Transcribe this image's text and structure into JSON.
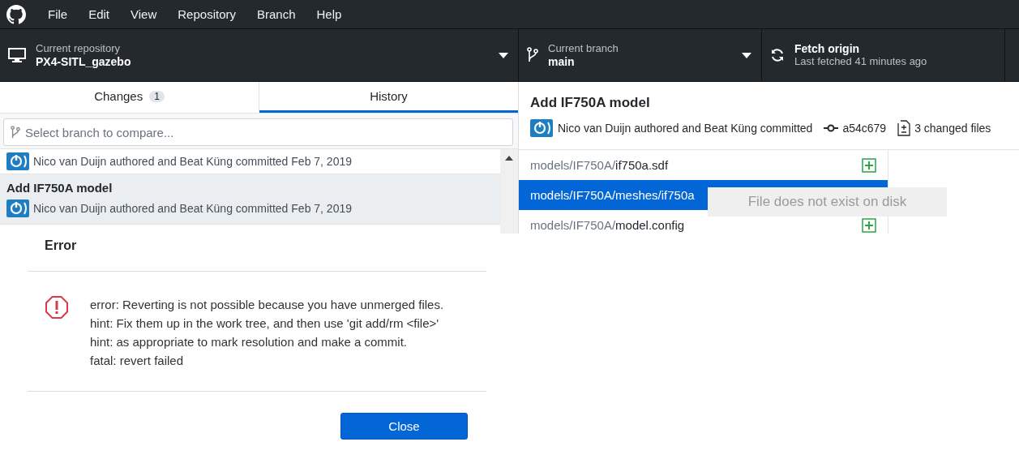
{
  "menu": [
    "File",
    "Edit",
    "View",
    "Repository",
    "Branch",
    "Help"
  ],
  "toolbar": {
    "repository": {
      "label": "Current repository",
      "value": "PX4-SITL_gazebo"
    },
    "branch": {
      "label": "Current branch",
      "value": "main"
    },
    "fetch": {
      "label": "Fetch origin",
      "value": "Last fetched 41 minutes ago"
    }
  },
  "tabs": [
    {
      "label": "Changes",
      "count": "1",
      "selected": false
    },
    {
      "label": "History",
      "selected": true
    }
  ],
  "compare": {
    "placeholder": "Select branch to compare..."
  },
  "commits": [
    {
      "author_line": "Nico van Duijn authored and Beat Küng committed Feb 7, 2019",
      "selected": false
    },
    {
      "title": "Add IF750A model",
      "author_line": "Nico van Duijn authored and Beat Küng committed Feb 7, 2019",
      "selected": true
    }
  ],
  "commit_detail": {
    "title": "Add IF750A model",
    "authors": "Nico van Duijn authored and Beat Küng committed",
    "sha": "a54c679",
    "changed_files": "3 changed files"
  },
  "files": [
    {
      "dir": "models/IF750A/",
      "name": "if750a.sdf",
      "kind": "added",
      "selected": false
    },
    {
      "dir": "models/IF750A/meshes/",
      "name": "if750a",
      "selected": true
    },
    {
      "dir": "models/IF750A/",
      "name": "model.config",
      "kind": "added",
      "selected": false
    }
  ],
  "tooltip": "File does not exist on disk",
  "dialog": {
    "title": "Error",
    "lines": [
      "error: Reverting is not possible because you have unmerged files.",
      "hint: Fix them up in the work tree, and then use 'git add/rm <file>'",
      "hint: as appropriate to mark resolution and make a commit.",
      "fatal: revert failed"
    ],
    "button": "Close"
  }
}
